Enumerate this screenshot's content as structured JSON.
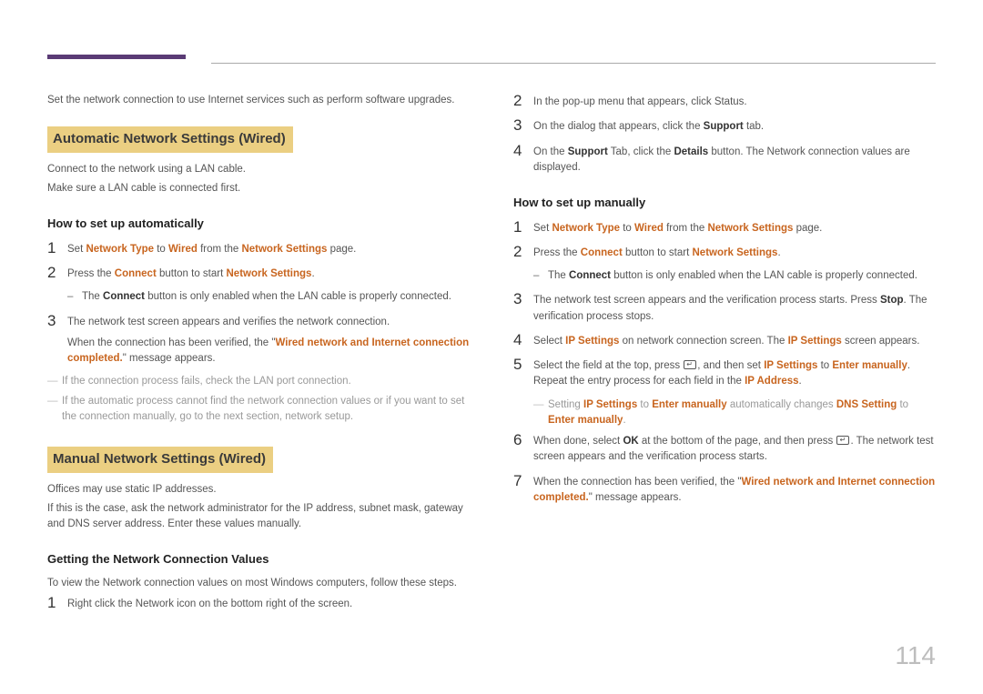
{
  "page_number": "114",
  "left": {
    "intro": "Set the network connection to use Internet services such as perform software upgrades.",
    "section_auto_title": "Automatic Network Settings (Wired)",
    "auto_p1": "Connect to the network using a LAN cable.",
    "auto_p2": "Make sure a LAN cable is connected first.",
    "auto_sub": "How to set up automatically",
    "auto_s1_a": "Set ",
    "auto_s1_b": "Network Type",
    "auto_s1_c": " to ",
    "auto_s1_d": "Wired",
    "auto_s1_e": " from the ",
    "auto_s1_f": "Network Settings",
    "auto_s1_g": " page.",
    "auto_s2_a": "Press the ",
    "auto_s2_b": "Connect",
    "auto_s2_c": " button to start ",
    "auto_s2_d": "Network Settings",
    "auto_s2_e": ".",
    "auto_s2_sub_a": "The ",
    "auto_s2_sub_b": "Connect",
    "auto_s2_sub_c": " button is only enabled when the LAN cable is properly connected.",
    "auto_s3_a": "The network test screen appears and verifies the network connection.",
    "auto_s3_b1": "When the connection has been verified, the \"",
    "auto_s3_b2": "Wired network and Internet connection completed.",
    "auto_s3_b3": "\" message appears.",
    "auto_note1": "If the connection process fails, check the LAN port connection.",
    "auto_note2": "If the automatic process cannot find the network connection values or if you want to set the connection manually, go to the next section, network setup.",
    "section_manual_title": "Manual Network Settings (Wired)",
    "man_p1": "Offices may use static IP addresses.",
    "man_p2": "If this is the case, ask the network administrator for the IP address, subnet mask, gateway and DNS server address. Enter these values manually.",
    "man_sub": "Getting the Network Connection Values",
    "man_intro": "To view the Network connection values on most Windows computers, follow these steps.",
    "man_s1": "Right click the Network icon on the bottom right of the screen."
  },
  "right": {
    "s2": "In the pop-up menu that appears, click Status.",
    "s3_a": "On the dialog that appears, click the ",
    "s3_b": "Support",
    "s3_c": " tab.",
    "s4_a": "On the ",
    "s4_b": "Support",
    "s4_c": " Tab, click the ",
    "s4_d": "Details",
    "s4_e": " button. The Network connection values are displayed.",
    "sub": "How to set up manually",
    "m1_a": "Set ",
    "m1_b": "Network Type",
    "m1_c": " to ",
    "m1_d": "Wired",
    "m1_e": " from the ",
    "m1_f": "Network Settings",
    "m1_g": " page.",
    "m2_a": "Press the ",
    "m2_b": "Connect",
    "m2_c": " button to start ",
    "m2_d": "Network Settings",
    "m2_e": ".",
    "m2_sub_a": "The ",
    "m2_sub_b": "Connect",
    "m2_sub_c": " button is only enabled when the LAN cable is properly connected.",
    "m3_a": "The network test screen appears and the verification process starts. Press ",
    "m3_b": "Stop",
    "m3_c": ". The verification process stops.",
    "m4_a": "Select ",
    "m4_b": "IP Settings",
    "m4_c": " on network connection screen. The ",
    "m4_d": "IP Settings",
    "m4_e": " screen appears.",
    "m5_a": "Select the field at the top, press ",
    "m5_b": ", and then set ",
    "m5_c": "IP Settings",
    "m5_d": " to ",
    "m5_e": "Enter manually",
    "m5_f": ". Repeat the entry process for each field in the ",
    "m5_g": "IP Address",
    "m5_h": ".",
    "m5_note_a": "Setting ",
    "m5_note_b": "IP Settings",
    "m5_note_c": " to ",
    "m5_note_d": "Enter manually",
    "m5_note_e": " automatically changes ",
    "m5_note_f": "DNS Setting",
    "m5_note_g": " to ",
    "m5_note_h": "Enter manually",
    "m5_note_i": ".",
    "m6_a": "When done, select ",
    "m6_b": "OK",
    "m6_c": " at the bottom of the page, and then press ",
    "m6_d": ". The network test screen appears and the verification process starts.",
    "m7_a": "When the connection has been verified, the \"",
    "m7_b": "Wired network and Internet connection completed.",
    "m7_c": "\" message appears."
  }
}
